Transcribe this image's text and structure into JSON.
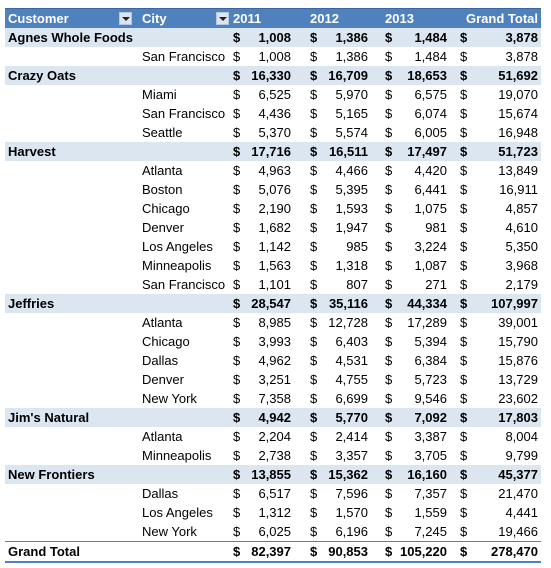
{
  "header": {
    "customer": "Customer",
    "city": "City",
    "years": [
      "2011",
      "2012",
      "2013"
    ],
    "grand_total": "Grand Total",
    "filter_icon": "dropdown-filter-icon"
  },
  "currency": "$",
  "customers": [
    {
      "name": "Agnes Whole Foods",
      "totals": [
        "1,008",
        "1,386",
        "1,484",
        "3,878"
      ],
      "cities": [
        {
          "city": "San Francisco",
          "values": [
            "1,008",
            "1,386",
            "1,484",
            "3,878"
          ]
        }
      ]
    },
    {
      "name": "Crazy Oats",
      "totals": [
        "16,330",
        "16,709",
        "18,653",
        "51,692"
      ],
      "cities": [
        {
          "city": "Miami",
          "values": [
            "6,525",
            "5,970",
            "6,575",
            "19,070"
          ]
        },
        {
          "city": "San Francisco",
          "values": [
            "4,436",
            "5,165",
            "6,074",
            "15,674"
          ]
        },
        {
          "city": "Seattle",
          "values": [
            "5,370",
            "5,574",
            "6,005",
            "16,948"
          ]
        }
      ]
    },
    {
      "name": "Harvest",
      "totals": [
        "17,716",
        "16,511",
        "17,497",
        "51,723"
      ],
      "cities": [
        {
          "city": "Atlanta",
          "values": [
            "4,963",
            "4,466",
            "4,420",
            "13,849"
          ]
        },
        {
          "city": "Boston",
          "values": [
            "5,076",
            "5,395",
            "6,441",
            "16,911"
          ]
        },
        {
          "city": "Chicago",
          "values": [
            "2,190",
            "1,593",
            "1,075",
            "4,857"
          ]
        },
        {
          "city": "Denver",
          "values": [
            "1,682",
            "1,947",
            "981",
            "4,610"
          ]
        },
        {
          "city": "Los Angeles",
          "values": [
            "1,142",
            "985",
            "3,224",
            "5,350"
          ]
        },
        {
          "city": "Minneapolis",
          "values": [
            "1,563",
            "1,318",
            "1,087",
            "3,968"
          ]
        },
        {
          "city": "San Francisco",
          "values": [
            "1,101",
            "807",
            "271",
            "2,179"
          ]
        }
      ]
    },
    {
      "name": "Jeffries",
      "totals": [
        "28,547",
        "35,116",
        "44,334",
        "107,997"
      ],
      "cities": [
        {
          "city": "Atlanta",
          "values": [
            "8,985",
            "12,728",
            "17,289",
            "39,001"
          ]
        },
        {
          "city": "Chicago",
          "values": [
            "3,993",
            "6,403",
            "5,394",
            "15,790"
          ]
        },
        {
          "city": "Dallas",
          "values": [
            "4,962",
            "4,531",
            "6,384",
            "15,876"
          ]
        },
        {
          "city": "Denver",
          "values": [
            "3,251",
            "4,755",
            "5,723",
            "13,729"
          ]
        },
        {
          "city": "New York",
          "values": [
            "7,358",
            "6,699",
            "9,546",
            "23,602"
          ]
        }
      ]
    },
    {
      "name": "Jim's Natural",
      "totals": [
        "4,942",
        "5,770",
        "7,092",
        "17,803"
      ],
      "cities": [
        {
          "city": "Atlanta",
          "values": [
            "2,204",
            "2,414",
            "3,387",
            "8,004"
          ]
        },
        {
          "city": "Minneapolis",
          "values": [
            "2,738",
            "3,357",
            "3,705",
            "9,799"
          ]
        }
      ]
    },
    {
      "name": "New Frontiers",
      "totals": [
        "13,855",
        "15,362",
        "16,160",
        "45,377"
      ],
      "cities": [
        {
          "city": "Dallas",
          "values": [
            "6,517",
            "7,596",
            "7,357",
            "21,470"
          ]
        },
        {
          "city": "Los Angeles",
          "values": [
            "1,312",
            "1,570",
            "1,559",
            "4,441"
          ]
        },
        {
          "city": "New York",
          "values": [
            "6,025",
            "6,196",
            "7,245",
            "19,466"
          ]
        }
      ]
    }
  ],
  "grand_total": {
    "label": "Grand Total",
    "values": [
      "82,397",
      "90,853",
      "105,220",
      "278,470"
    ]
  },
  "colors": {
    "header_bg": "#4f81bd",
    "customer_row_bg": "#dce6f1"
  }
}
